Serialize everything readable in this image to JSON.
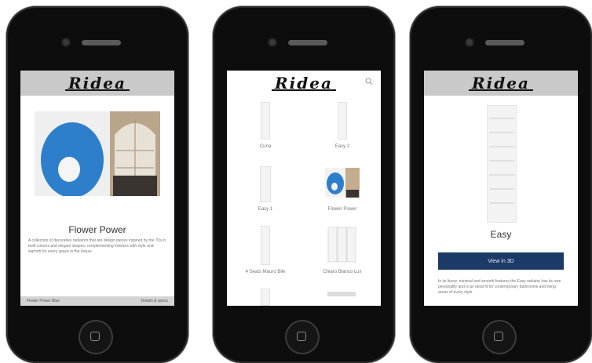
{
  "brand": {
    "logo_text": "Ridea"
  },
  "phone1": {
    "title": "Flower Power",
    "body": "A collection of decorative radiators that are design pieces inspired by the 70s in bold colours and elegant shapes, complementing interiors with style and warmth for every space in the house.",
    "footer_left": "Flower Power Blue",
    "footer_right": "Details & specs"
  },
  "phone2": {
    "products": [
      {
        "label": "Cuna"
      },
      {
        "label": "Easy 2"
      },
      {
        "label": "Easy 1"
      },
      {
        "label": "Flower Power"
      },
      {
        "label": "4 Seats Mauro Bile"
      },
      {
        "label": "Chiaro Bianco Lux"
      }
    ]
  },
  "phone3": {
    "title": "Easy",
    "button_label": "View in 3D",
    "body": "In its linear, minimal and smooth features the Easy radiator has its own personality and is an ideal fit for contemporary bathrooms and living areas of every style."
  },
  "colors": {
    "brand_blue": "#1b3a66",
    "flower_blue": "#2e7fcb",
    "header_grey": "#c9c9c9"
  }
}
